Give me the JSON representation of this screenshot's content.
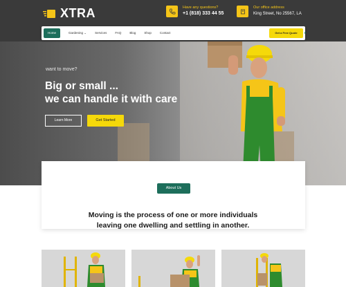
{
  "brand": {
    "name": "XTRA"
  },
  "header": {
    "phone": {
      "label": "Have any questions?",
      "value": "+1 (818) 333 44 55"
    },
    "address": {
      "label": "Our office address",
      "value": "King Street, No 25567, LA"
    }
  },
  "nav": {
    "items": [
      "Home",
      "Gardening",
      "Services",
      "FAQ",
      "Blog",
      "Shop",
      "Contact"
    ],
    "gardening_caret": "⌄",
    "social": [
      "f",
      "t",
      "s"
    ],
    "quote": "Get a Free Quote"
  },
  "hero": {
    "subtitle": "want to move?",
    "title_line1": "Big or small ...",
    "title_line2": "we can handle it with care",
    "learn_more": "Learn More",
    "get_started": "Get Started"
  },
  "about": {
    "pill": "About Us",
    "text_line1": "Moving is the process of one or more individuals",
    "text_line2": "leaving one dwelling and settling in another."
  },
  "colors": {
    "accent": "#1d6e5b",
    "highlight": "#f5d90a",
    "worker_shirt": "#f5c518",
    "worker_overalls": "#2e8b2e"
  }
}
